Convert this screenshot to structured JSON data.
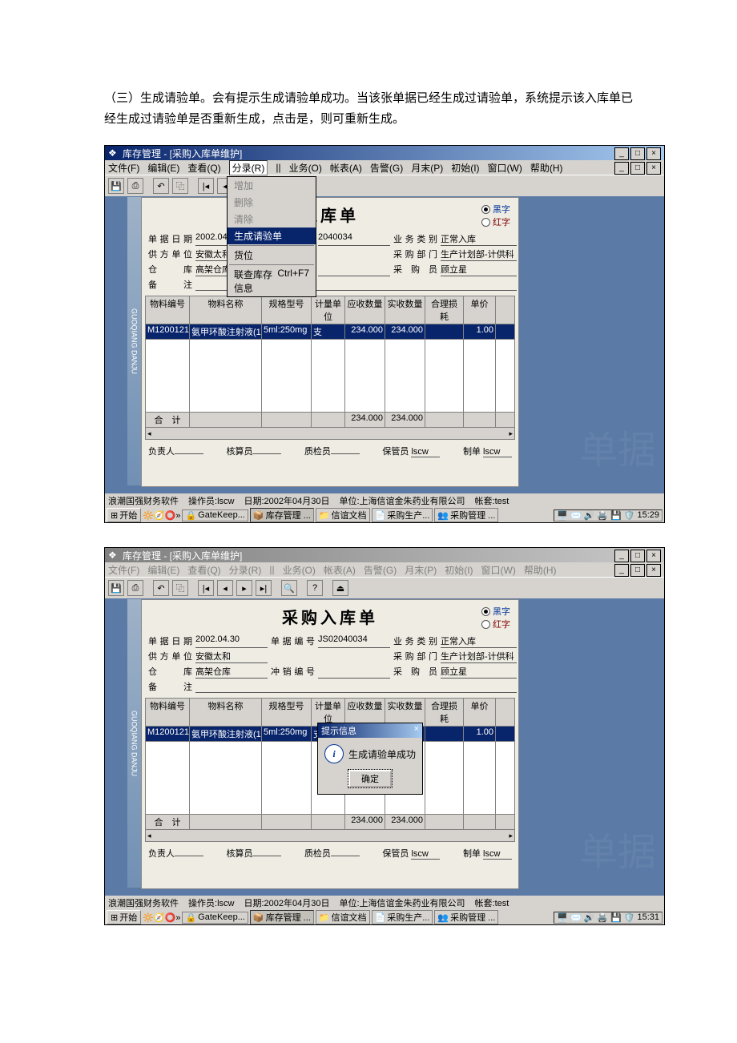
{
  "caption": "（三）生成请验单。会有提示生成请验单成功。当该张单据已经生成过请验单，系统提示该入库单已经生成过请验单是否重新生成，点击是，则可重新生成。",
  "window": {
    "title": "库存管理 - [采购入库单维护]"
  },
  "menu": {
    "file": "文件(F)",
    "edit": "编辑(E)",
    "view": "查看(Q)",
    "split": "分录(R)",
    "sep": "||",
    "biz": "业务(O)",
    "report": "帐表(A)",
    "alert": "告警(G)",
    "month": "月末(P)",
    "init": "初始(I)",
    "windowm": "窗口(W)",
    "help": "帮助(H)"
  },
  "dropdown": {
    "add": "增加",
    "delete": "删除",
    "clear": "清除",
    "gen": "生成请验单",
    "loc": "货位",
    "stock": "联查库存信息",
    "stock_key": "Ctrl+F7"
  },
  "form": {
    "title": "采购入库单",
    "title_cut": "入库单",
    "radio_blue": "黑字",
    "radio_red": "红字",
    "l_date": "单据日期",
    "v_date": "2002.04.30",
    "v_date_cut": "2002.04",
    "l_no": "单据编号",
    "v_no": "JS02040034",
    "v_no_cut": "2040034",
    "l_type": "业务类别",
    "v_type": "正常入库",
    "l_supplier": "供方单位",
    "v_supplier": "安徽太和",
    "l_dept": "采购部门",
    "v_dept": "生产计划部-计供科",
    "l_wh": "仓　库",
    "v_wh": "高架仓库",
    "l_rushno": "冲销编号",
    "l_buyer": "采 购 员",
    "v_buyer": "顾立星",
    "l_remark": "备　注"
  },
  "table": {
    "h1": "物料编号",
    "h2": "物料名称",
    "h3": "规格型号",
    "h4": "计量单位",
    "h5": "应收数量",
    "h6": "实收数量",
    "h7": "合理损耗",
    "h8": "单价",
    "r1": {
      "c1": "M1200121",
      "c2": "氨甲环酸注射液(1",
      "c3": "5ml:250mg",
      "c4": "支",
      "c5": "234.000",
      "c6": "234.000",
      "c7": "",
      "c8": "1.00"
    },
    "sum": "合　计",
    "s5": "234.000",
    "s6": "234.000"
  },
  "signs": {
    "fzr": "负责人",
    "hsy": "核算员",
    "zjy": "质检员",
    "bgy": "保管员",
    "bgy_v": "lscw",
    "zd": "制单",
    "zd_v": "lscw"
  },
  "status": {
    "prod": "浪潮国强财务软件",
    "oper_l": "操作员:",
    "oper": "lscw",
    "date_l": "日期:",
    "date": "2002年04月30日",
    "unit_l": "单位:",
    "unit": "上海信谊金朱药业有限公司",
    "ac_l": "帐套:",
    "ac": "test"
  },
  "taskbar": {
    "start": "开始",
    "t1": "GateKeep...",
    "t2": "库存管理 ...",
    "t3": "信谊文档",
    "t4": "采购生产...",
    "t5": "采购管理 ...",
    "time1": "15:29",
    "time2": "15:31"
  },
  "modal": {
    "title": "提示信息",
    "msg": "生成请验单成功",
    "ok": "确定"
  }
}
